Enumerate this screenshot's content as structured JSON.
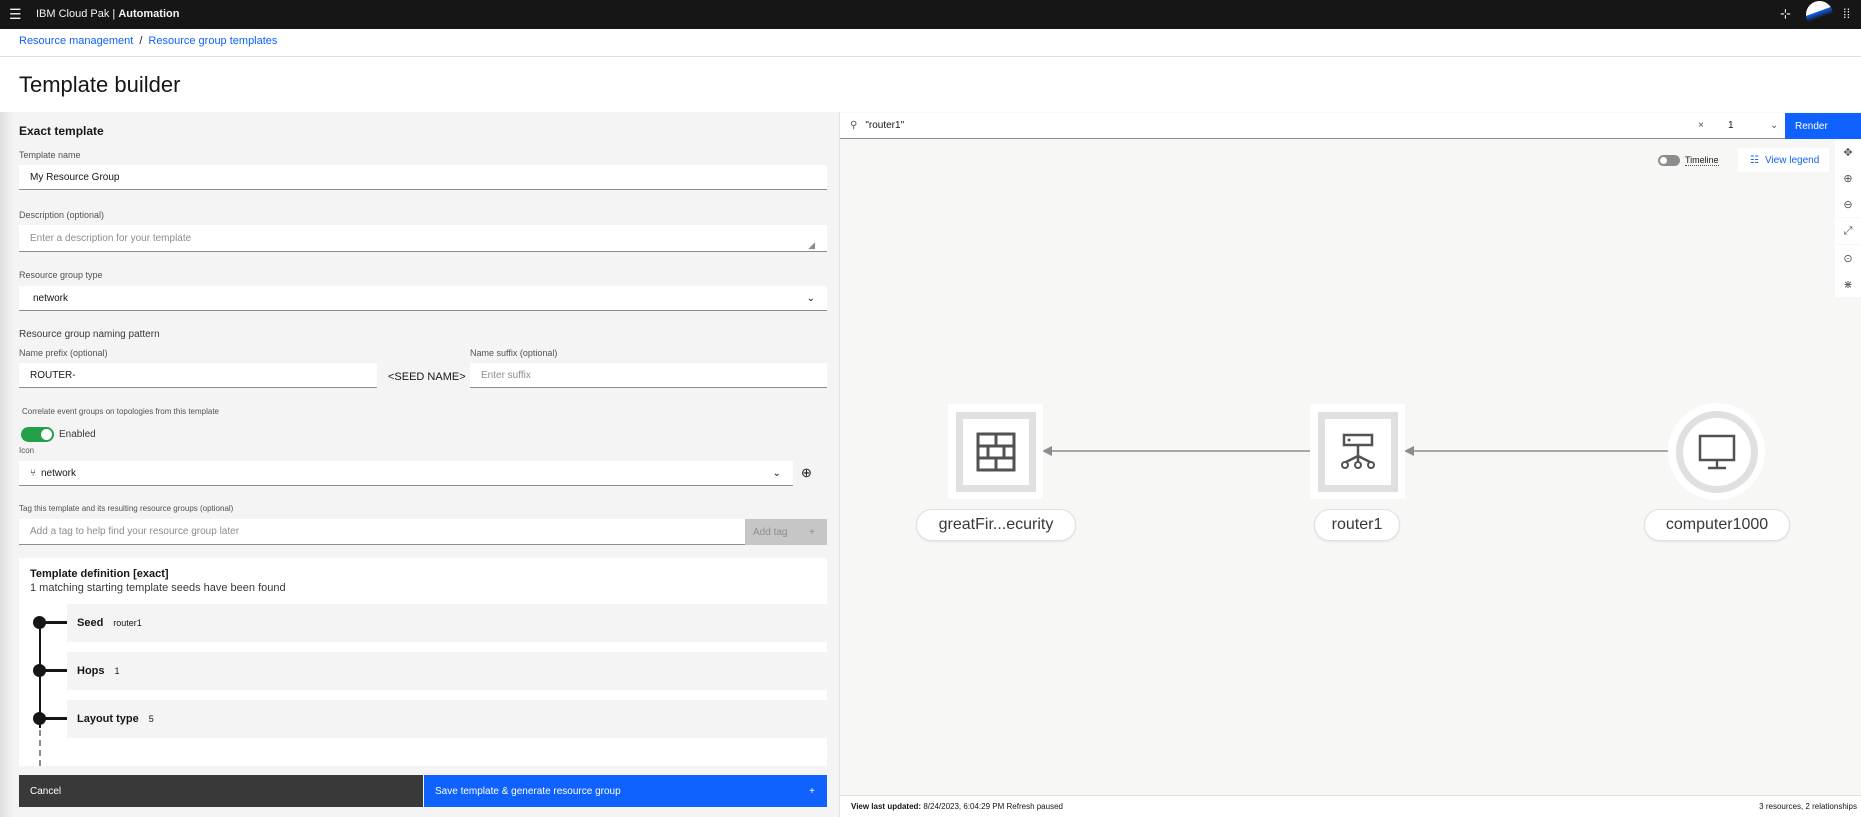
{
  "header": {
    "brand": "IBM Cloud Pak",
    "product": "Automation",
    "menu_icon": "hamburger-icon",
    "pin_icon": "pin-icon",
    "avatar": "user-avatar",
    "apps_icon": "app-switcher-icon"
  },
  "breadcrumb": [
    {
      "label": "Resource management"
    },
    {
      "label": "Resource group templates"
    }
  ],
  "page_title": "Template builder",
  "form": {
    "section_title": "Exact template",
    "template_name": {
      "label": "Template name",
      "value": "My Resource Group"
    },
    "description": {
      "label": "Description (optional)",
      "placeholder": "Enter a description for your template"
    },
    "group_type": {
      "label": "Resource group type",
      "value": "network"
    },
    "naming": {
      "title": "Resource group naming pattern",
      "prefix_label": "Name prefix (optional)",
      "prefix_value": "ROUTER-",
      "seed": "<SEED NAME>",
      "suffix_label": "Name suffix (optional)",
      "suffix_placeholder": "Enter suffix"
    },
    "correlate": {
      "label": "Correlate event groups on topologies from this template",
      "toggle_label": "Enabled",
      "enabled": true
    },
    "icon": {
      "label": "Icon",
      "value": "network"
    },
    "tag": {
      "label": "Tag this template and its resulting resource groups (optional)",
      "placeholder": "Add a tag to help find your resource group later",
      "button": "Add tag"
    }
  },
  "definition": {
    "title": "Template definition [exact]",
    "subtitle": "1 matching starting template seeds have been found",
    "steps": [
      {
        "name": "Seed",
        "value": "router1"
      },
      {
        "name": "Hops",
        "value": "1"
      },
      {
        "name": "Layout type",
        "value": "5"
      }
    ]
  },
  "actions": {
    "cancel": "Cancel",
    "save": "Save template & generate resource group"
  },
  "topology": {
    "search_value": "\"router1\"",
    "hops": "1",
    "render": "Render",
    "timeline": "Timeline",
    "timeline_on": false,
    "view_legend": "View legend",
    "toolbar": [
      "move-icon",
      "zoom-in-icon",
      "zoom-out-icon",
      "fit-icon",
      "location-icon",
      "layout-icon"
    ],
    "nodes": [
      {
        "label": "greatFir...ecurity",
        "icon": "firewall-icon"
      },
      {
        "label": "router1",
        "icon": "router-icon"
      },
      {
        "label": "computer1000",
        "icon": "computer-icon"
      }
    ],
    "footer": {
      "updated_label": "View last updated:",
      "updated_value": "8/24/2023, 6:04:29 PM Refresh paused",
      "counts": "3 resources, 2 relationships"
    }
  },
  "colors": {
    "primary": "#0f62fe",
    "toggle_on": "#24a148",
    "header": "#161616"
  }
}
